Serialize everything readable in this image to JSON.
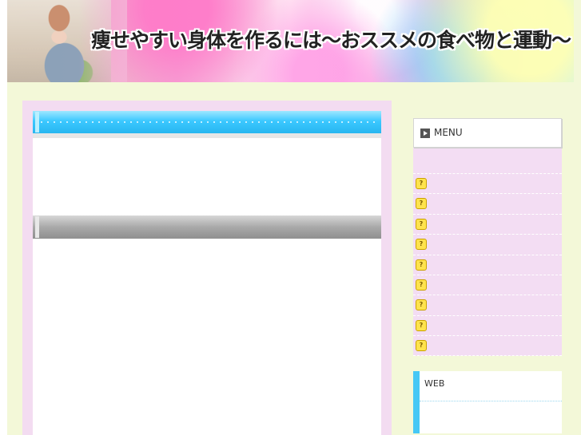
{
  "header": {
    "title": "痩せやすい身体を作るには〜おススメの食べ物と運動〜"
  },
  "main": {
    "section_1_title": "",
    "section_2_title": ""
  },
  "sidebar": {
    "menu_title": "MENU",
    "menu_items": [
      {
        "icon": "question-icon",
        "label": ""
      },
      {
        "icon": "question-icon",
        "label": ""
      },
      {
        "icon": "question-icon",
        "label": ""
      },
      {
        "icon": "question-icon",
        "label": ""
      },
      {
        "icon": "question-icon",
        "label": ""
      },
      {
        "icon": "question-icon",
        "label": ""
      },
      {
        "icon": "question-icon",
        "label": ""
      },
      {
        "icon": "question-icon",
        "label": ""
      },
      {
        "icon": "question-icon",
        "label": ""
      }
    ],
    "web_title": "WEB"
  },
  "colors": {
    "page_bg": "#f3f8d8",
    "main_frame": "#f3dcf1",
    "blue_bar": "#3cc8ff",
    "gray_bar": "#a9a9a9",
    "web_accent": "#46c8f5"
  }
}
